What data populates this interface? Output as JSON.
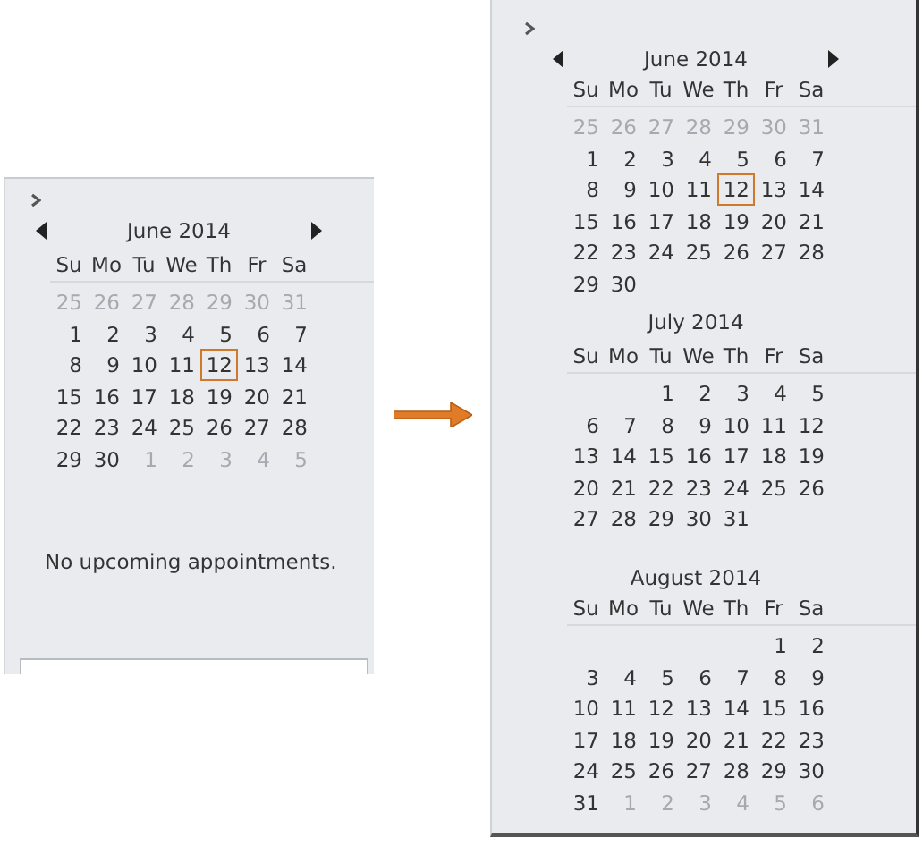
{
  "panels": [
    {
      "months": [
        {
          "title": "June 2014",
          "has_arrows": true,
          "weekdays": [
            "Su",
            "Mo",
            "Tu",
            "We",
            "Th",
            "Fr",
            "Sa"
          ],
          "weeks": [
            {
              "days": [
                {
                  "day": "25",
                  "muted": true,
                  "today": false
                },
                {
                  "day": "26",
                  "muted": true,
                  "today": false
                },
                {
                  "day": "27",
                  "muted": true,
                  "today": false
                },
                {
                  "day": "28",
                  "muted": true,
                  "today": false
                },
                {
                  "day": "29",
                  "muted": true,
                  "today": false
                },
                {
                  "day": "30",
                  "muted": true,
                  "today": false
                },
                {
                  "day": "31",
                  "muted": true,
                  "today": false
                }
              ]
            },
            {
              "days": [
                {
                  "day": "1",
                  "muted": false,
                  "today": false
                },
                {
                  "day": "2",
                  "muted": false,
                  "today": false
                },
                {
                  "day": "3",
                  "muted": false,
                  "today": false
                },
                {
                  "day": "4",
                  "muted": false,
                  "today": false
                },
                {
                  "day": "5",
                  "muted": false,
                  "today": false
                },
                {
                  "day": "6",
                  "muted": false,
                  "today": false
                },
                {
                  "day": "7",
                  "muted": false,
                  "today": false
                }
              ]
            },
            {
              "days": [
                {
                  "day": "8",
                  "muted": false,
                  "today": false
                },
                {
                  "day": "9",
                  "muted": false,
                  "today": false
                },
                {
                  "day": "10",
                  "muted": false,
                  "today": false
                },
                {
                  "day": "11",
                  "muted": false,
                  "today": false
                },
                {
                  "day": "12",
                  "muted": false,
                  "today": true
                },
                {
                  "day": "13",
                  "muted": false,
                  "today": false
                },
                {
                  "day": "14",
                  "muted": false,
                  "today": false
                }
              ]
            },
            {
              "days": [
                {
                  "day": "15",
                  "muted": false,
                  "today": false
                },
                {
                  "day": "16",
                  "muted": false,
                  "today": false
                },
                {
                  "day": "17",
                  "muted": false,
                  "today": false
                },
                {
                  "day": "18",
                  "muted": false,
                  "today": false
                },
                {
                  "day": "19",
                  "muted": false,
                  "today": false
                },
                {
                  "day": "20",
                  "muted": false,
                  "today": false
                },
                {
                  "day": "21",
                  "muted": false,
                  "today": false
                }
              ]
            },
            {
              "days": [
                {
                  "day": "22",
                  "muted": false,
                  "today": false
                },
                {
                  "day": "23",
                  "muted": false,
                  "today": false
                },
                {
                  "day": "24",
                  "muted": false,
                  "today": false
                },
                {
                  "day": "25",
                  "muted": false,
                  "today": false
                },
                {
                  "day": "26",
                  "muted": false,
                  "today": false
                },
                {
                  "day": "27",
                  "muted": false,
                  "today": false
                },
                {
                  "day": "28",
                  "muted": false,
                  "today": false
                }
              ]
            },
            {
              "days": [
                {
                  "day": "29",
                  "muted": false,
                  "today": false
                },
                {
                  "day": "30",
                  "muted": false,
                  "today": false
                },
                {
                  "day": "1",
                  "muted": true,
                  "today": false
                },
                {
                  "day": "2",
                  "muted": true,
                  "today": false
                },
                {
                  "day": "3",
                  "muted": true,
                  "today": false
                },
                {
                  "day": "4",
                  "muted": true,
                  "today": false
                },
                {
                  "day": "5",
                  "muted": true,
                  "today": false
                }
              ]
            }
          ]
        }
      ],
      "message": "No upcoming appointments."
    },
    {
      "months": [
        {
          "title": "June 2014",
          "has_arrows": true,
          "weekdays": [
            "Su",
            "Mo",
            "Tu",
            "We",
            "Th",
            "Fr",
            "Sa"
          ],
          "weeks": [
            {
              "days": [
                {
                  "day": "25",
                  "muted": true,
                  "today": false
                },
                {
                  "day": "26",
                  "muted": true,
                  "today": false
                },
                {
                  "day": "27",
                  "muted": true,
                  "today": false
                },
                {
                  "day": "28",
                  "muted": true,
                  "today": false
                },
                {
                  "day": "29",
                  "muted": true,
                  "today": false
                },
                {
                  "day": "30",
                  "muted": true,
                  "today": false
                },
                {
                  "day": "31",
                  "muted": true,
                  "today": false
                }
              ]
            },
            {
              "days": [
                {
                  "day": "1",
                  "muted": false,
                  "today": false
                },
                {
                  "day": "2",
                  "muted": false,
                  "today": false
                },
                {
                  "day": "3",
                  "muted": false,
                  "today": false
                },
                {
                  "day": "4",
                  "muted": false,
                  "today": false
                },
                {
                  "day": "5",
                  "muted": false,
                  "today": false
                },
                {
                  "day": "6",
                  "muted": false,
                  "today": false
                },
                {
                  "day": "7",
                  "muted": false,
                  "today": false
                }
              ]
            },
            {
              "days": [
                {
                  "day": "8",
                  "muted": false,
                  "today": false
                },
                {
                  "day": "9",
                  "muted": false,
                  "today": false
                },
                {
                  "day": "10",
                  "muted": false,
                  "today": false
                },
                {
                  "day": "11",
                  "muted": false,
                  "today": false
                },
                {
                  "day": "12",
                  "muted": false,
                  "today": true
                },
                {
                  "day": "13",
                  "muted": false,
                  "today": false
                },
                {
                  "day": "14",
                  "muted": false,
                  "today": false
                }
              ]
            },
            {
              "days": [
                {
                  "day": "15",
                  "muted": false,
                  "today": false
                },
                {
                  "day": "16",
                  "muted": false,
                  "today": false
                },
                {
                  "day": "17",
                  "muted": false,
                  "today": false
                },
                {
                  "day": "18",
                  "muted": false,
                  "today": false
                },
                {
                  "day": "19",
                  "muted": false,
                  "today": false
                },
                {
                  "day": "20",
                  "muted": false,
                  "today": false
                },
                {
                  "day": "21",
                  "muted": false,
                  "today": false
                }
              ]
            },
            {
              "days": [
                {
                  "day": "22",
                  "muted": false,
                  "today": false
                },
                {
                  "day": "23",
                  "muted": false,
                  "today": false
                },
                {
                  "day": "24",
                  "muted": false,
                  "today": false
                },
                {
                  "day": "25",
                  "muted": false,
                  "today": false
                },
                {
                  "day": "26",
                  "muted": false,
                  "today": false
                },
                {
                  "day": "27",
                  "muted": false,
                  "today": false
                },
                {
                  "day": "28",
                  "muted": false,
                  "today": false
                }
              ]
            },
            {
              "right_aligned": false,
              "days": [
                {
                  "day": "29",
                  "muted": false,
                  "today": false
                },
                {
                  "day": "30",
                  "muted": false,
                  "today": false
                }
              ]
            }
          ]
        },
        {
          "title": "July 2014",
          "has_arrows": false,
          "weekdays": [
            "Su",
            "Mo",
            "Tu",
            "We",
            "Th",
            "Fr",
            "Sa"
          ],
          "weeks": [
            {
              "right_aligned": true,
              "days": [
                {
                  "day": "1",
                  "muted": false,
                  "today": false
                },
                {
                  "day": "2",
                  "muted": false,
                  "today": false
                },
                {
                  "day": "3",
                  "muted": false,
                  "today": false
                },
                {
                  "day": "4",
                  "muted": false,
                  "today": false
                },
                {
                  "day": "5",
                  "muted": false,
                  "today": false
                }
              ]
            },
            {
              "days": [
                {
                  "day": "6",
                  "muted": false,
                  "today": false
                },
                {
                  "day": "7",
                  "muted": false,
                  "today": false
                },
                {
                  "day": "8",
                  "muted": false,
                  "today": false
                },
                {
                  "day": "9",
                  "muted": false,
                  "today": false
                },
                {
                  "day": "10",
                  "muted": false,
                  "today": false
                },
                {
                  "day": "11",
                  "muted": false,
                  "today": false
                },
                {
                  "day": "12",
                  "muted": false,
                  "today": false
                }
              ]
            },
            {
              "days": [
                {
                  "day": "13",
                  "muted": false,
                  "today": false
                },
                {
                  "day": "14",
                  "muted": false,
                  "today": false
                },
                {
                  "day": "15",
                  "muted": false,
                  "today": false
                },
                {
                  "day": "16",
                  "muted": false,
                  "today": false
                },
                {
                  "day": "17",
                  "muted": false,
                  "today": false
                },
                {
                  "day": "18",
                  "muted": false,
                  "today": false
                },
                {
                  "day": "19",
                  "muted": false,
                  "today": false
                }
              ]
            },
            {
              "days": [
                {
                  "day": "20",
                  "muted": false,
                  "today": false
                },
                {
                  "day": "21",
                  "muted": false,
                  "today": false
                },
                {
                  "day": "22",
                  "muted": false,
                  "today": false
                },
                {
                  "day": "23",
                  "muted": false,
                  "today": false
                },
                {
                  "day": "24",
                  "muted": false,
                  "today": false
                },
                {
                  "day": "25",
                  "muted": false,
                  "today": false
                },
                {
                  "day": "26",
                  "muted": false,
                  "today": false
                }
              ]
            },
            {
              "right_aligned": false,
              "days": [
                {
                  "day": "27",
                  "muted": false,
                  "today": false
                },
                {
                  "day": "28",
                  "muted": false,
                  "today": false
                },
                {
                  "day": "29",
                  "muted": false,
                  "today": false
                },
                {
                  "day": "30",
                  "muted": false,
                  "today": false
                },
                {
                  "day": "31",
                  "muted": false,
                  "today": false
                }
              ]
            }
          ]
        },
        {
          "title": "August 2014",
          "has_arrows": false,
          "weekdays": [
            "Su",
            "Mo",
            "Tu",
            "We",
            "Th",
            "Fr",
            "Sa"
          ],
          "weeks": [
            {
              "right_aligned": true,
              "days": [
                {
                  "day": "1",
                  "muted": false,
                  "today": false
                },
                {
                  "day": "2",
                  "muted": false,
                  "today": false
                }
              ]
            },
            {
              "days": [
                {
                  "day": "3",
                  "muted": false,
                  "today": false
                },
                {
                  "day": "4",
                  "muted": false,
                  "today": false
                },
                {
                  "day": "5",
                  "muted": false,
                  "today": false
                },
                {
                  "day": "6",
                  "muted": false,
                  "today": false
                },
                {
                  "day": "7",
                  "muted": false,
                  "today": false
                },
                {
                  "day": "8",
                  "muted": false,
                  "today": false
                },
                {
                  "day": "9",
                  "muted": false,
                  "today": false
                }
              ]
            },
            {
              "days": [
                {
                  "day": "10",
                  "muted": false,
                  "today": false
                },
                {
                  "day": "11",
                  "muted": false,
                  "today": false
                },
                {
                  "day": "12",
                  "muted": false,
                  "today": false
                },
                {
                  "day": "13",
                  "muted": false,
                  "today": false
                },
                {
                  "day": "14",
                  "muted": false,
                  "today": false
                },
                {
                  "day": "15",
                  "muted": false,
                  "today": false
                },
                {
                  "day": "16",
                  "muted": false,
                  "today": false
                }
              ]
            },
            {
              "days": [
                {
                  "day": "17",
                  "muted": false,
                  "today": false
                },
                {
                  "day": "18",
                  "muted": false,
                  "today": false
                },
                {
                  "day": "19",
                  "muted": false,
                  "today": false
                },
                {
                  "day": "20",
                  "muted": false,
                  "today": false
                },
                {
                  "day": "21",
                  "muted": false,
                  "today": false
                },
                {
                  "day": "22",
                  "muted": false,
                  "today": false
                },
                {
                  "day": "23",
                  "muted": false,
                  "today": false
                }
              ]
            },
            {
              "days": [
                {
                  "day": "24",
                  "muted": false,
                  "today": false
                },
                {
                  "day": "25",
                  "muted": false,
                  "today": false
                },
                {
                  "day": "26",
                  "muted": false,
                  "today": false
                },
                {
                  "day": "27",
                  "muted": false,
                  "today": false
                },
                {
                  "day": "28",
                  "muted": false,
                  "today": false
                },
                {
                  "day": "29",
                  "muted": false,
                  "today": false
                },
                {
                  "day": "30",
                  "muted": false,
                  "today": false
                }
              ]
            },
            {
              "days": [
                {
                  "day": "31",
                  "muted": false,
                  "today": false
                },
                {
                  "day": "1",
                  "muted": true,
                  "today": false
                },
                {
                  "day": "2",
                  "muted": true,
                  "today": false
                },
                {
                  "day": "3",
                  "muted": true,
                  "today": false
                },
                {
                  "day": "4",
                  "muted": true,
                  "today": false
                },
                {
                  "day": "5",
                  "muted": true,
                  "today": false
                },
                {
                  "day": "6",
                  "muted": true,
                  "today": false
                }
              ]
            }
          ]
        }
      ]
    }
  ]
}
